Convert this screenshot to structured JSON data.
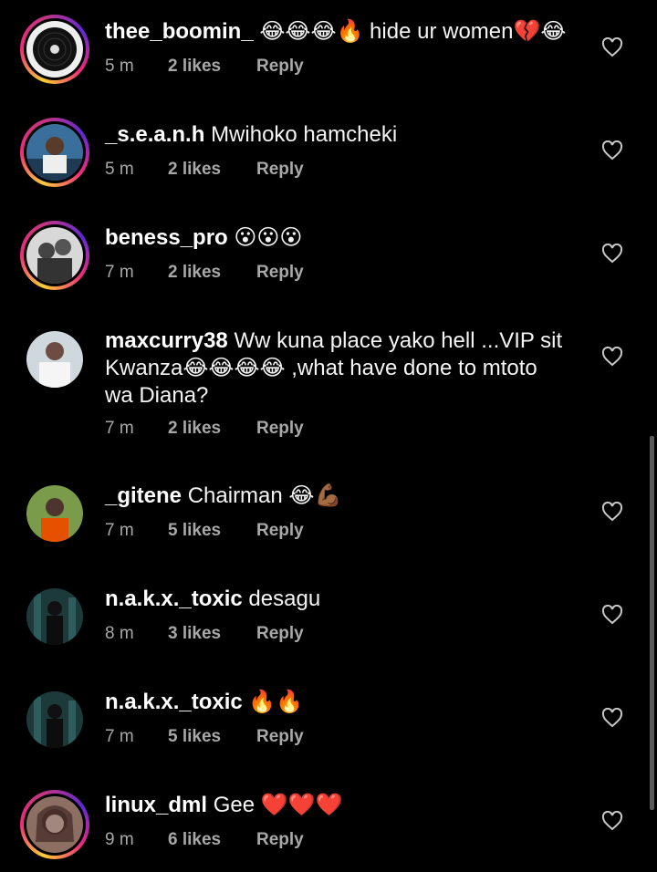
{
  "comments": [
    {
      "username": "thee_boomin_",
      "text": "😂😂😂🔥 hide ur women💔😂",
      "time": "5 m",
      "likes": "2 likes",
      "reply": "Reply"
    },
    {
      "username": "_s.e.a.n.h",
      "text": "Mwihoko hamcheki",
      "time": "5 m",
      "likes": "2 likes",
      "reply": "Reply"
    },
    {
      "username": "beness_pro",
      "text": "😮😮😮",
      "time": "7 m",
      "likes": "2 likes",
      "reply": "Reply"
    },
    {
      "username": "maxcurry38",
      "text_line1": "Ww kuna place yako hell ...VIP sit",
      "text_line2": "Kwanza😂😂😂😂 ,what have done to mtoto",
      "text_line3": "wa Diana?",
      "time": "7 m",
      "likes": "2 likes",
      "reply": "Reply"
    },
    {
      "username": "_gitene",
      "text": "Chairman 😂💪🏾",
      "time": "7 m",
      "likes": "5 likes",
      "reply": "Reply"
    },
    {
      "username": "n.a.k.x._toxic",
      "text": "desagu",
      "time": "8 m",
      "likes": "3 likes",
      "reply": "Reply"
    },
    {
      "username": "n.a.k.x._toxic",
      "text": "🔥🔥",
      "time": "7 m",
      "likes": "5 likes",
      "reply": "Reply"
    },
    {
      "username": "linux_dml",
      "text": "Gee ❤️❤️❤️",
      "time": "9 m",
      "likes": "6 likes",
      "reply": "Reply"
    }
  ],
  "icons": {
    "like": "heart-outline-icon"
  },
  "colors": {
    "background": "#000000",
    "meta": "#a8a8a8",
    "story_ring_start": "#f9ce34",
    "story_ring_end": "#ee2a7b"
  }
}
